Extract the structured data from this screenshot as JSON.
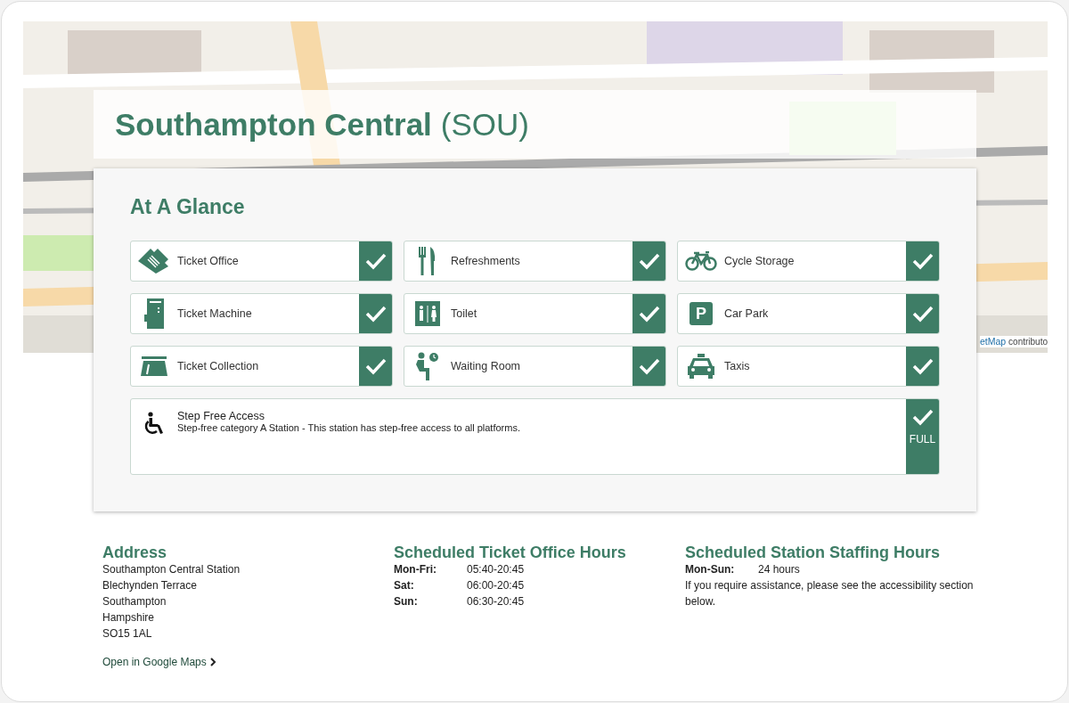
{
  "map": {
    "attribution_link": "etMap",
    "attribution": "contributo"
  },
  "station": {
    "name": "Southampton Central",
    "code": "(SOU)"
  },
  "at_a_glance": {
    "title": "At A Glance",
    "facilities": [
      {
        "label": "Ticket Office",
        "available": true
      },
      {
        "label": "Refreshments",
        "available": true
      },
      {
        "label": "Cycle Storage",
        "available": true
      },
      {
        "label": "Ticket Machine",
        "available": true
      },
      {
        "label": "Toilet",
        "available": true
      },
      {
        "label": "Car Park",
        "icon_text": "P",
        "available": true
      },
      {
        "label": "Ticket Collection",
        "available": true
      },
      {
        "label": "Waiting Room",
        "available": true
      },
      {
        "label": "Taxis",
        "available": true
      }
    ],
    "step_free": {
      "label": "Step Free Access",
      "description": "Step-free category A Station - This station has step-free access to all platforms.",
      "available": true,
      "status": "FULL"
    }
  },
  "address": {
    "title": "Address",
    "lines": [
      "Southampton Central Station",
      "Blechynden Terrace",
      "Southampton",
      "Hampshire",
      "SO15 1AL"
    ],
    "link": "Open in Google Maps"
  },
  "ticket_office_hours": {
    "title": "Scheduled Ticket Office Hours",
    "rows": [
      {
        "day": "Mon-Fri:",
        "hours": "05:40-20:45"
      },
      {
        "day": "Sat:",
        "hours": "06:00-20:45"
      },
      {
        "day": "Sun:",
        "hours": "06:30-20:45"
      }
    ]
  },
  "staffing_hours": {
    "title": "Scheduled Station Staffing Hours",
    "rows": [
      {
        "day": "Mon-Sun:",
        "hours": "24 hours"
      }
    ],
    "note": "If you require assistance, please see the accessibility section below."
  }
}
